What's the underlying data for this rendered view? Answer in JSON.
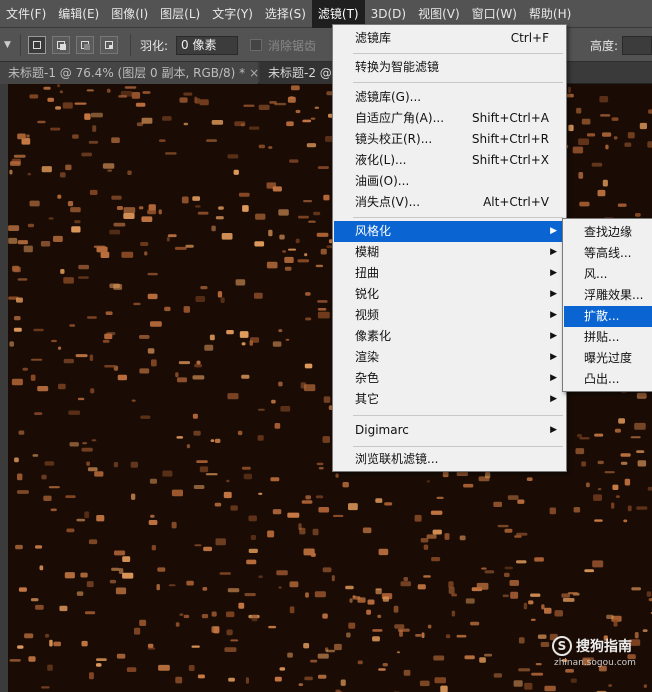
{
  "menubar": {
    "items": [
      "文件(F)",
      "编辑(E)",
      "图像(I)",
      "图层(L)",
      "文字(Y)",
      "选择(S)",
      "滤镜(T)",
      "3D(D)",
      "视图(V)",
      "窗口(W)",
      "帮助(H)"
    ],
    "active_index": 6
  },
  "options": {
    "dropdown_icon": "triangle-down",
    "feather_label": "羽化:",
    "feather_value": "0 像素",
    "anti_alias_label": "消除锯齿",
    "height_label": "高度:"
  },
  "tabs": [
    {
      "label": "未标题-1 @ 76.4% (图层 0 副本, RGB/8) *",
      "close": "×"
    },
    {
      "label": "未标题-2 @"
    }
  ],
  "filter_menu": {
    "items": [
      {
        "label": "滤镜库",
        "shortcut": "Ctrl+F"
      },
      {
        "label": "转换为智能滤镜"
      },
      {
        "label": "滤镜库(G)..."
      },
      {
        "label": "自适应广角(A)...",
        "shortcut": "Shift+Ctrl+A"
      },
      {
        "label": "镜头校正(R)...",
        "shortcut": "Shift+Ctrl+R"
      },
      {
        "label": "液化(L)...",
        "shortcut": "Shift+Ctrl+X"
      },
      {
        "label": "油画(O)..."
      },
      {
        "label": "消失点(V)...",
        "shortcut": "Alt+Ctrl+V"
      },
      {
        "label": "风格化",
        "submenu": true
      },
      {
        "label": "模糊",
        "submenu": true
      },
      {
        "label": "扭曲",
        "submenu": true
      },
      {
        "label": "锐化",
        "submenu": true
      },
      {
        "label": "视频",
        "submenu": true
      },
      {
        "label": "像素化",
        "submenu": true
      },
      {
        "label": "渲染",
        "submenu": true
      },
      {
        "label": "杂色",
        "submenu": true
      },
      {
        "label": "其它",
        "submenu": true
      },
      {
        "label": "Digimarc",
        "submenu": true
      },
      {
        "label": "浏览联机滤镜..."
      }
    ],
    "highlighted_index": 8,
    "submenu_arrow": "▶"
  },
  "stylize_submenu": {
    "items": [
      "查找边缘",
      "等高线...",
      "风...",
      "浮雕效果...",
      "扩散...",
      "拼贴...",
      "曝光过度",
      "凸出..."
    ],
    "highlighted_index": 4
  },
  "watermark": {
    "icon_glyph": "S",
    "text": "搜狗指南",
    "url": "zhinan.sogou.com"
  },
  "colors": {
    "chrome": "#535353",
    "menu_bg": "#f0f0f0",
    "highlight": "#0a64d1",
    "canvas_dark": "#1a0c05",
    "canvas_copper": "#c97a45"
  }
}
